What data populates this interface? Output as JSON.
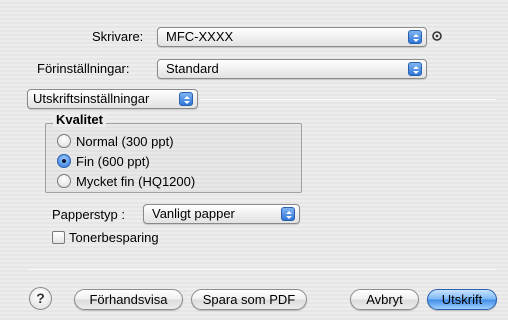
{
  "printer": {
    "label": "Skrivare:",
    "value": "MFC-XXXX"
  },
  "presets": {
    "label": "Förinställningar:",
    "value": "Standard"
  },
  "section_popup": {
    "value": "Utskriftsinställningar"
  },
  "quality": {
    "title": "Kvalitet",
    "options": [
      {
        "label": "Normal (300 ppt)",
        "selected": false
      },
      {
        "label": "Fin (600 ppt)",
        "selected": true
      },
      {
        "label": "Mycket fin (HQ1200)",
        "selected": false
      }
    ]
  },
  "paper_type": {
    "label": "Papperstyp :",
    "value": "Vanligt papper"
  },
  "toner_saving": {
    "label": "Tonerbesparing",
    "checked": false
  },
  "buttons": {
    "help": "?",
    "preview": "Förhandsvisa",
    "save_pdf": "Spara som PDF",
    "cancel": "Avbryt",
    "print": "Utskrift"
  },
  "colors": {
    "accent": "#3f8be6",
    "background": "#ececec"
  }
}
